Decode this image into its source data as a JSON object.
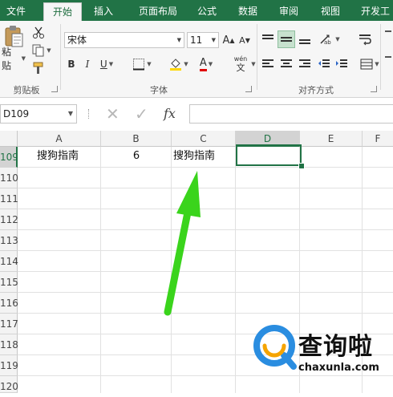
{
  "ribbon_tabs": [
    {
      "label": "文件",
      "active": false
    },
    {
      "label": "开始",
      "active": true
    },
    {
      "label": "插入",
      "active": false
    },
    {
      "label": "页面布局",
      "active": false
    },
    {
      "label": "公式",
      "active": false
    },
    {
      "label": "数据",
      "active": false
    },
    {
      "label": "审阅",
      "active": false
    },
    {
      "label": "视图",
      "active": false
    },
    {
      "label": "开发工",
      "active": false
    }
  ],
  "clipboard": {
    "paste_label": "粘贴",
    "group_label": "剪贴板"
  },
  "font": {
    "name": "宋体",
    "size": "11",
    "bold": "B",
    "italic": "I",
    "underline": "U",
    "font_color_glyph": "A",
    "phonetic_top": "wén",
    "phonetic_bottom": "文",
    "grow_glyph": "A",
    "shrink_glyph": "A",
    "group_label": "字体"
  },
  "alignment": {
    "group_label": "对齐方式"
  },
  "formula_bar": {
    "name_box": "D109",
    "cancel_glyph": "✕",
    "enter_glyph": "✓",
    "fx_label": "fx",
    "formula": ""
  },
  "columns": [
    "A",
    "B",
    "C",
    "D",
    "E",
    "F"
  ],
  "selected_column": "D",
  "rows": [
    {
      "label": "109",
      "selected": true
    },
    {
      "label": "110",
      "selected": false
    },
    {
      "label": "111",
      "selected": false
    },
    {
      "label": "112",
      "selected": false
    },
    {
      "label": "113",
      "selected": false
    },
    {
      "label": "114",
      "selected": false
    },
    {
      "label": "115",
      "selected": false
    },
    {
      "label": "116",
      "selected": false
    },
    {
      "label": "117",
      "selected": false
    },
    {
      "label": "118",
      "selected": false
    },
    {
      "label": "119",
      "selected": false
    },
    {
      "label": "120",
      "selected": false
    }
  ],
  "cells": {
    "A109": "搜狗指南",
    "B109": "6",
    "C109": "搜狗指南",
    "D109": ""
  },
  "annotation": {
    "arrow_color": "#3ad41c",
    "points_to": "C109"
  },
  "watermark": {
    "title": "查询啦",
    "url": "chaxunla.com",
    "logo_color": "#2a8de0",
    "accent_color": "#f5a400"
  },
  "colors": {
    "excel_green": "#217346",
    "header_gray": "#f3f3f3",
    "selected_header": "#d3d3d3"
  }
}
